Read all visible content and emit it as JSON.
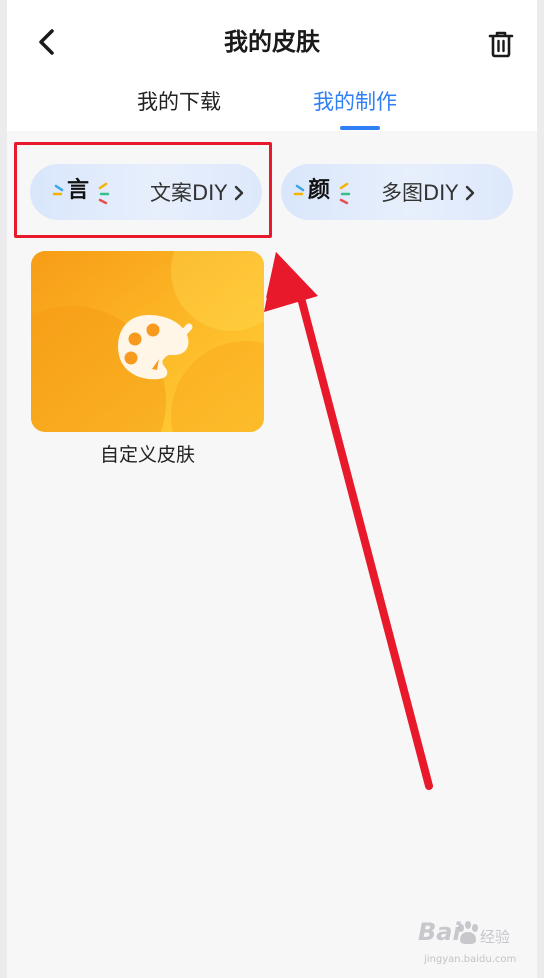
{
  "header": {
    "title": "我的皮肤",
    "back_icon": "chevron-left-icon",
    "delete_icon": "trash-icon"
  },
  "tabs": [
    {
      "label": "我的下载",
      "active": false
    },
    {
      "label": "我的制作",
      "active": true
    }
  ],
  "diy_buttons": [
    {
      "icon_text": "言",
      "label": "文案DIY"
    },
    {
      "icon_text": "颜",
      "label": "多图DIY"
    }
  ],
  "skins": [
    {
      "name": "自定义皮肤",
      "icon": "palette-icon"
    }
  ],
  "annotations": {
    "highlight_color": "#e8192a",
    "arrow_color": "#e8192a"
  },
  "watermark": {
    "brand": "Bai",
    "product": "经验",
    "url": "jingyan.baidu.com"
  },
  "colors": {
    "accent": "#2f7ff5",
    "card_orange": "#f7a21f",
    "card_yellow": "#ffd338"
  }
}
